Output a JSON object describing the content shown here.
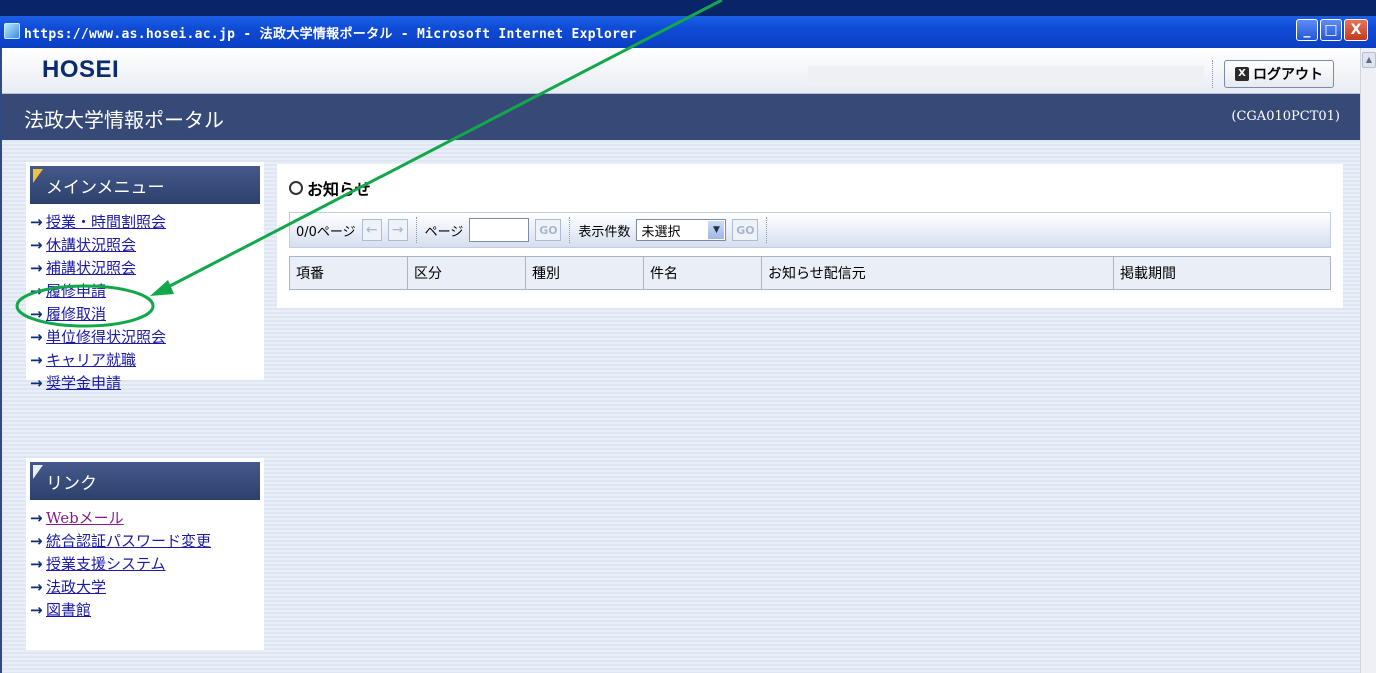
{
  "window": {
    "title": "https://www.as.hosei.ac.jp - 法政大学情報ポータル - Microsoft Internet Explorer",
    "buttons": [
      "_",
      "□",
      "X"
    ]
  },
  "topbar": {
    "logo": "HOSEI",
    "logout_label": "ログアウト"
  },
  "header": {
    "title": "法政大学情報ポータル",
    "screen_id": "(CGA010PCT01)"
  },
  "main_menu": {
    "title": "メインメニュー",
    "items": [
      {
        "label": "授業・時間割照会"
      },
      {
        "label": "休講状況照会"
      },
      {
        "label": "補講状況照会"
      },
      {
        "label": "履修申請"
      },
      {
        "label": "履修取消"
      },
      {
        "label": "単位修得状況照会"
      },
      {
        "label": "キャリア就職"
      },
      {
        "label": "奨学金申請"
      }
    ]
  },
  "links": {
    "title": "リンク",
    "items": [
      {
        "label": "Webメール"
      },
      {
        "label": "統合認証パスワード変更"
      },
      {
        "label": "授業支援システム"
      },
      {
        "label": "法政大学"
      },
      {
        "label": "図書館"
      }
    ]
  },
  "notice": {
    "title": "お知らせ",
    "toolbar": {
      "page_count": "0/0ページ",
      "page_label": "ページ",
      "page_value": "",
      "go_label": "GO",
      "count_label": "表示件数",
      "count_selected": "未選択",
      "go2_label": "GO"
    },
    "columns": [
      "項番",
      "区分",
      "種別",
      "件名",
      "お知らせ配信元",
      "掲載期間"
    ]
  },
  "annotation": {
    "color": "#11a84a",
    "target": "履修申請"
  },
  "icons": {
    "arrow": "→",
    "nav_prev": "←",
    "nav_next": "→",
    "dropdown": "▼",
    "logout_box": "X"
  }
}
